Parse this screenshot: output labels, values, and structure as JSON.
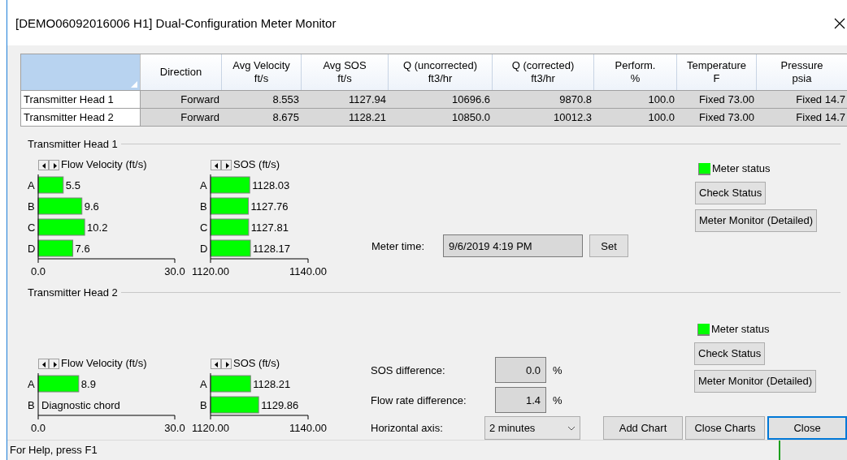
{
  "window": {
    "title": "[DEMO06092016006 H1] Dual-Configuration Meter Monitor"
  },
  "table": {
    "columns": [
      {
        "name": "Direction"
      },
      {
        "name": "Avg Velocity",
        "unit": "ft/s"
      },
      {
        "name": "Avg SOS",
        "unit": "ft/s"
      },
      {
        "name": "Q (uncorrected)",
        "unit": "ft3/hr"
      },
      {
        "name": "Q (corrected)",
        "unit": "ft3/hr"
      },
      {
        "name": "Perform.",
        "unit": "%"
      },
      {
        "name": "Temperature",
        "unit": "F"
      },
      {
        "name": "Pressure",
        "unit": "psia"
      }
    ],
    "rows": [
      {
        "head": "Transmitter Head 1",
        "cells": [
          "Forward",
          "8.553",
          "1127.94",
          "10696.6",
          "9870.8",
          "100.0",
          "Fixed 73.00",
          "Fixed 14.7"
        ]
      },
      {
        "head": "Transmitter Head 2",
        "cells": [
          "Forward",
          "8.675",
          "1128.21",
          "10850.0",
          "10012.3",
          "100.0",
          "Fixed 73.00",
          "Fixed 14.7"
        ]
      }
    ]
  },
  "heads": [
    {
      "title": "Transmitter Head 1",
      "charts": [
        {
          "chart_data": {
            "type": "bar",
            "orientation": "horizontal",
            "title": "Flow Velocity (ft/s)",
            "categories": [
              "A",
              "B",
              "C",
              "D"
            ],
            "values": [
              5.5,
              9.6,
              10.2,
              7.6
            ],
            "value_labels": [
              "5.5",
              "9.6",
              "10.2",
              "7.6"
            ],
            "xlim": [
              0,
              30
            ],
            "xticks": [
              {
                "value": 0,
                "label": "0.0"
              },
              {
                "value": 30,
                "label": "30.0"
              }
            ]
          }
        },
        {
          "chart_data": {
            "type": "bar",
            "orientation": "horizontal",
            "title": "SOS (ft/s)",
            "categories": [
              "A",
              "B",
              "C",
              "D"
            ],
            "values": [
              1128.03,
              1127.76,
              1127.81,
              1128.17
            ],
            "value_labels": [
              "1128.03",
              "1127.76",
              "1127.81",
              "1128.17"
            ],
            "xlim": [
              1120,
              1140
            ],
            "xticks": [
              {
                "value": 1120,
                "label": "1120.00"
              },
              {
                "value": 1140,
                "label": "1140.00"
              }
            ]
          }
        }
      ],
      "meter_status": {
        "label": "Meter status",
        "color": "#00ff00"
      },
      "buttons": [
        "Check Status",
        "Meter Monitor (Detailed)"
      ]
    },
    {
      "title": "Transmitter Head 2",
      "charts": [
        {
          "chart_data": {
            "type": "bar",
            "orientation": "horizontal",
            "title": "Flow Velocity (ft/s)",
            "categories": [
              "A",
              "B"
            ],
            "values": [
              8.9,
              null
            ],
            "value_labels": [
              "8.9",
              null
            ],
            "xlim": [
              0,
              30
            ],
            "xticks": [
              {
                "value": 0,
                "label": "0.0"
              },
              {
                "value": 30,
                "label": "30.0"
              }
            ],
            "annotations": [
              {
                "text": "Diagnostic chord"
              }
            ]
          }
        },
        {
          "chart_data": {
            "type": "bar",
            "orientation": "horizontal",
            "title": "SOS (ft/s)",
            "categories": [
              "A",
              "B"
            ],
            "values": [
              1128.21,
              1129.86
            ],
            "value_labels": [
              "1128.21",
              "1129.86"
            ],
            "xlim": [
              1120,
              1140
            ],
            "xticks": [
              {
                "value": 1120,
                "label": "1120.00"
              },
              {
                "value": 1140,
                "label": "1140.00"
              }
            ]
          }
        }
      ],
      "meter_status": {
        "label": "Meter status",
        "color": "#00ff00"
      },
      "buttons": [
        "Check Status",
        "Meter Monitor (Detailed)"
      ]
    }
  ],
  "meter_time": {
    "label": "Meter time:",
    "value": "9/6/2019 4:19 PM",
    "button": "Set"
  },
  "differences": [
    {
      "label": "SOS difference:",
      "value": "0.0",
      "unit": "%"
    },
    {
      "label": "Flow rate difference:",
      "value": "1.4",
      "unit": "%"
    }
  ],
  "horizontal_axis": {
    "label": "Horizontal axis:",
    "value": "2 minutes"
  },
  "bottom_buttons": [
    {
      "label": "Add Chart",
      "focused": false
    },
    {
      "label": "Close Charts",
      "focused": false
    },
    {
      "label": "Close",
      "focused": true
    }
  ],
  "status_bar": {
    "text": "For Help, press F1"
  }
}
